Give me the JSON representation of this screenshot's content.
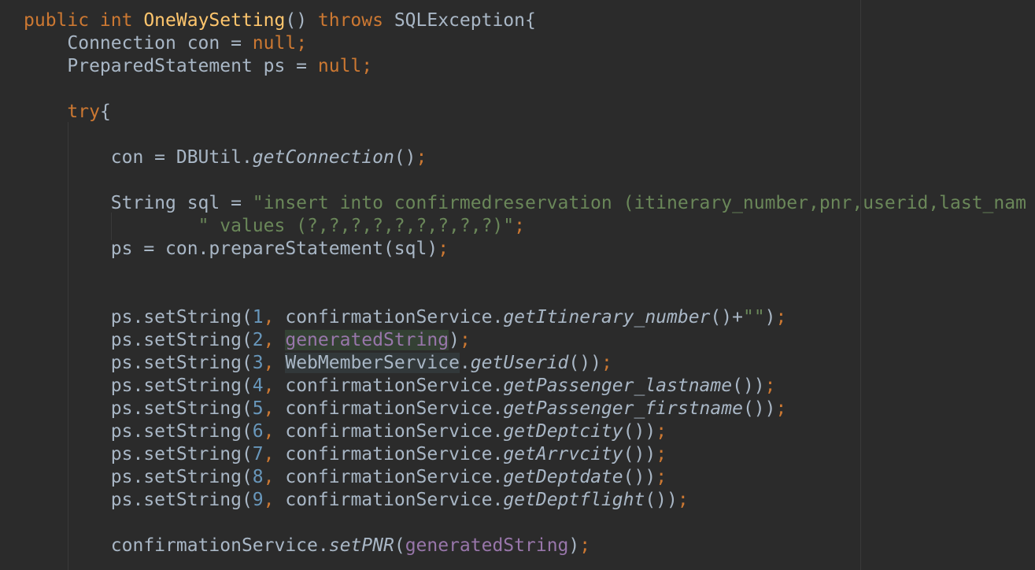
{
  "editor": {
    "lines": [
      {
        "parts": [
          {
            "t": "public int ",
            "c": "kw"
          },
          {
            "t": "OneWaySetting",
            "c": "fn"
          },
          {
            "t": "() ",
            "c": ""
          },
          {
            "t": "throws ",
            "c": "kw"
          },
          {
            "t": "SQLException{",
            "c": ""
          }
        ]
      },
      {
        "parts": [
          {
            "t": "    Connection con = ",
            "c": ""
          },
          {
            "t": "null",
            "c": "kw"
          },
          {
            "t": ";",
            "c": "kw"
          }
        ]
      },
      {
        "parts": [
          {
            "t": "    PreparedStatement ps = ",
            "c": ""
          },
          {
            "t": "null",
            "c": "kw"
          },
          {
            "t": ";",
            "c": "kw"
          }
        ]
      },
      {
        "parts": []
      },
      {
        "parts": [
          {
            "t": "    ",
            "c": ""
          },
          {
            "t": "try",
            "c": "kw"
          },
          {
            "t": "{",
            "c": ""
          }
        ]
      },
      {
        "parts": []
      },
      {
        "parts": [
          {
            "t": "        con = DBUtil.",
            "c": ""
          },
          {
            "t": "getConnection",
            "c": "static"
          },
          {
            "t": "()",
            "c": ""
          },
          {
            "t": ";",
            "c": "kw"
          }
        ]
      },
      {
        "parts": []
      },
      {
        "parts": [
          {
            "t": "        String sql = ",
            "c": ""
          },
          {
            "t": "\"insert into confirmedreservation (itinerary_number,pnr,userid,last_nam",
            "c": "str"
          }
        ]
      },
      {
        "parts": [
          {
            "t": "                ",
            "c": ""
          },
          {
            "t": "\" values (?,?,?,?,?,?,?,?,?)\"",
            "c": "str"
          },
          {
            "t": ";",
            "c": "kw"
          }
        ]
      },
      {
        "parts": [
          {
            "t": "        ps = con.prepareStatement(sql)",
            "c": ""
          },
          {
            "t": ";",
            "c": "kw"
          }
        ]
      },
      {
        "parts": []
      },
      {
        "parts": []
      },
      {
        "parts": [
          {
            "t": "        ps.setString(",
            "c": ""
          },
          {
            "t": "1",
            "c": "num"
          },
          {
            "t": ", ",
            "c": "kw"
          },
          {
            "t": "confirmationService.",
            "c": ""
          },
          {
            "t": "getItinerary_number",
            "c": "static"
          },
          {
            "t": "()+",
            "c": ""
          },
          {
            "t": "\"\"",
            "c": "str"
          },
          {
            "t": ")",
            "c": ""
          },
          {
            "t": ";",
            "c": "kw"
          }
        ]
      },
      {
        "parts": [
          {
            "t": "        ps.setString(",
            "c": ""
          },
          {
            "t": "2",
            "c": "num"
          },
          {
            "t": ", ",
            "c": "kw"
          },
          {
            "t": "generatedString",
            "c": "field hl"
          },
          {
            "t": ")",
            "c": ""
          },
          {
            "t": ";",
            "c": "kw"
          }
        ]
      },
      {
        "parts": [
          {
            "t": "        ps.setString(",
            "c": ""
          },
          {
            "t": "3",
            "c": "num"
          },
          {
            "t": ", ",
            "c": "kw"
          },
          {
            "t": "WebMemberService",
            "c": "cls-hl"
          },
          {
            "t": ".",
            "c": ""
          },
          {
            "t": "getUserid",
            "c": "static"
          },
          {
            "t": "())",
            "c": ""
          },
          {
            "t": ";",
            "c": "kw"
          }
        ]
      },
      {
        "parts": [
          {
            "t": "        ps.setString(",
            "c": ""
          },
          {
            "t": "4",
            "c": "num"
          },
          {
            "t": ", ",
            "c": "kw"
          },
          {
            "t": "confirmationService.",
            "c": ""
          },
          {
            "t": "getPassenger_lastname",
            "c": "static"
          },
          {
            "t": "())",
            "c": ""
          },
          {
            "t": ";",
            "c": "kw"
          }
        ]
      },
      {
        "parts": [
          {
            "t": "        ps.setString(",
            "c": ""
          },
          {
            "t": "5",
            "c": "num"
          },
          {
            "t": ", ",
            "c": "kw"
          },
          {
            "t": "confirmationService.",
            "c": ""
          },
          {
            "t": "getPassenger_firstname",
            "c": "static"
          },
          {
            "t": "())",
            "c": ""
          },
          {
            "t": ";",
            "c": "kw"
          }
        ]
      },
      {
        "parts": [
          {
            "t": "        ps.setString(",
            "c": ""
          },
          {
            "t": "6",
            "c": "num"
          },
          {
            "t": ", ",
            "c": "kw"
          },
          {
            "t": "confirmationService.",
            "c": ""
          },
          {
            "t": "getDeptcity",
            "c": "static"
          },
          {
            "t": "())",
            "c": ""
          },
          {
            "t": ";",
            "c": "kw"
          }
        ]
      },
      {
        "parts": [
          {
            "t": "        ps.setString(",
            "c": ""
          },
          {
            "t": "7",
            "c": "num"
          },
          {
            "t": ", ",
            "c": "kw"
          },
          {
            "t": "confirmationService.",
            "c": ""
          },
          {
            "t": "getArrvcity",
            "c": "static"
          },
          {
            "t": "())",
            "c": ""
          },
          {
            "t": ";",
            "c": "kw"
          }
        ]
      },
      {
        "parts": [
          {
            "t": "        ps.setString(",
            "c": ""
          },
          {
            "t": "8",
            "c": "num"
          },
          {
            "t": ", ",
            "c": "kw"
          },
          {
            "t": "confirmationService.",
            "c": ""
          },
          {
            "t": "getDeptdate",
            "c": "static"
          },
          {
            "t": "())",
            "c": ""
          },
          {
            "t": ";",
            "c": "kw"
          }
        ]
      },
      {
        "parts": [
          {
            "t": "        ps.setString(",
            "c": ""
          },
          {
            "t": "9",
            "c": "num"
          },
          {
            "t": ", ",
            "c": "kw"
          },
          {
            "t": "confirmationService.",
            "c": ""
          },
          {
            "t": "getDeptflight",
            "c": "static"
          },
          {
            "t": "())",
            "c": ""
          },
          {
            "t": ";",
            "c": "kw"
          }
        ]
      },
      {
        "parts": []
      },
      {
        "parts": [
          {
            "t": "        confirmationService.",
            "c": ""
          },
          {
            "t": "setPNR",
            "c": "static"
          },
          {
            "t": "(",
            "c": ""
          },
          {
            "t": "generatedString",
            "c": "field"
          },
          {
            "t": ")",
            "c": ""
          },
          {
            "t": ";",
            "c": "kw"
          }
        ]
      }
    ]
  },
  "colors": {
    "background": "#2b2b2b",
    "default_text": "#a9b7c6",
    "keyword": "#cc7832",
    "method_declaration": "#ffc66d",
    "string": "#6a8759",
    "number": "#6897bb",
    "field": "#9876aa"
  }
}
